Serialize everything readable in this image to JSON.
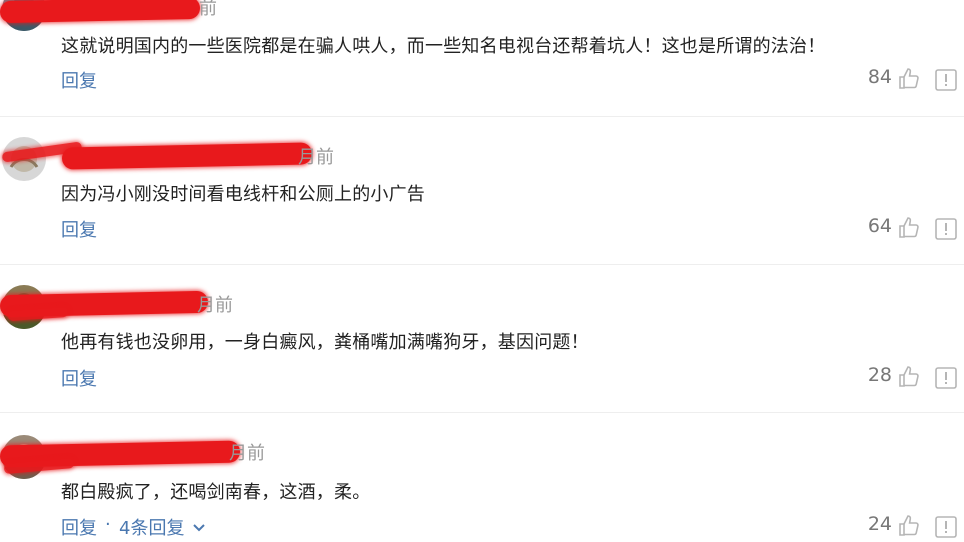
{
  "comments": [
    {
      "time_visible": "前",
      "text": "这就说明国内的一些医院都是在骗人哄人，而一些知名电视台还帮着坑人！这也是所谓的法治！",
      "reply_label": "回复",
      "likes": "84"
    },
    {
      "time_visible": "月前",
      "text": "因为冯小刚没时间看电线杆和公厕上的小广告",
      "reply_label": "回复",
      "likes": "64"
    },
    {
      "time_visible": "月前",
      "text": "他再有钱也没卵用，一身白癜风，粪桶嘴加满嘴狗牙，基因问题！",
      "reply_label": "回复",
      "likes": "28"
    },
    {
      "time_visible": "月前",
      "text": "都白殿疯了，还喝剑南春，这酒，柔。",
      "reply_label": "回复",
      "separator": "·",
      "replies_label": "4条回复",
      "likes": "24"
    }
  ],
  "icons": {
    "like": "thumbs-up-icon",
    "report": "report-icon",
    "expand": "chevron-down-icon"
  },
  "colors": {
    "link": "#4b78b0",
    "text": "#222222",
    "muted": "#999999",
    "redact": "#e8191c"
  }
}
